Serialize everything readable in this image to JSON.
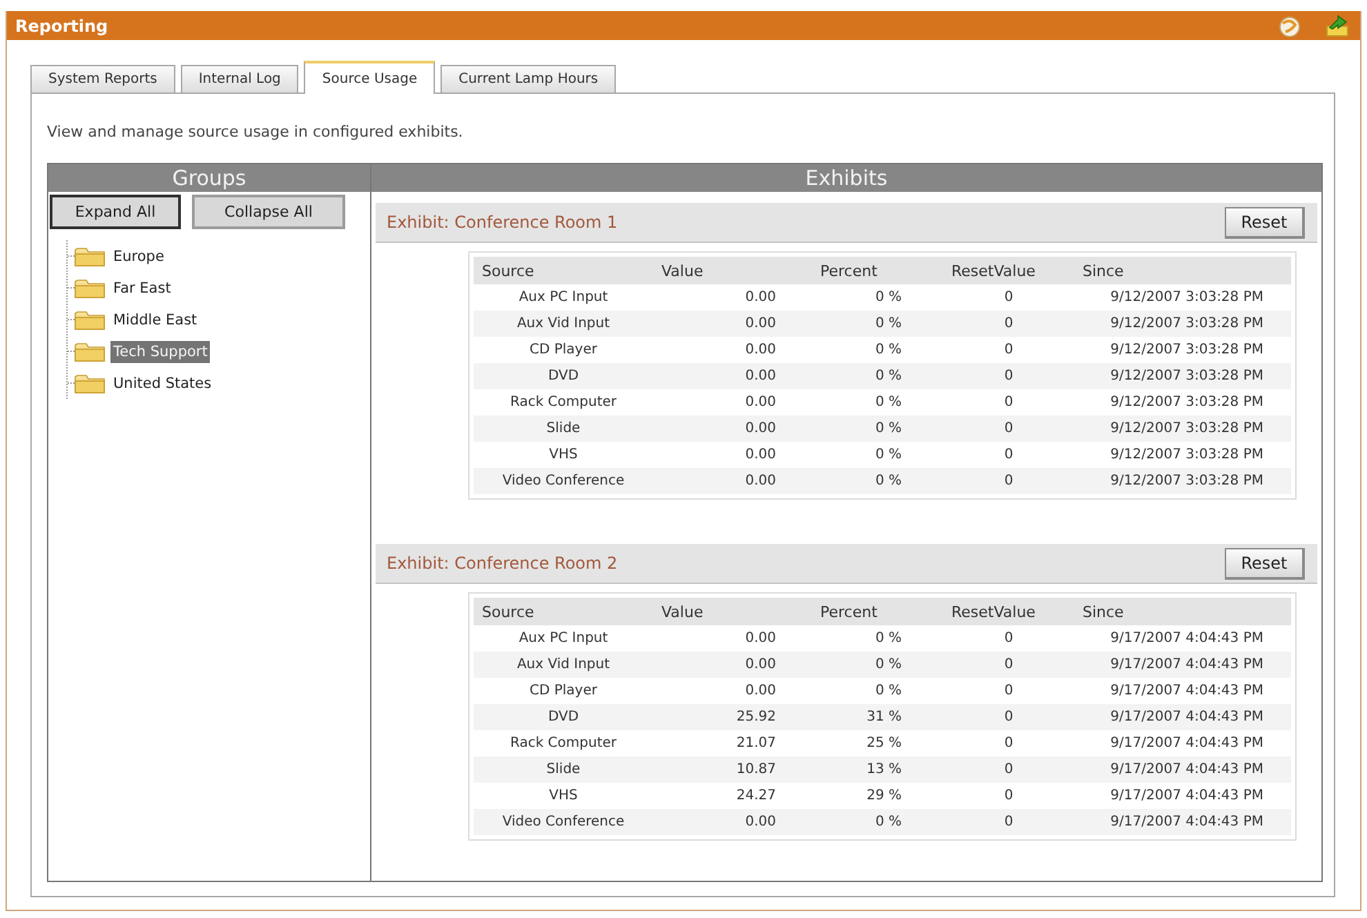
{
  "window": {
    "title": "Reporting"
  },
  "tabs": [
    {
      "label": "System Reports",
      "selected": false
    },
    {
      "label": "Internal Log",
      "selected": false
    },
    {
      "label": "Source Usage",
      "selected": true
    },
    {
      "label": "Current Lamp Hours",
      "selected": false
    }
  ],
  "description": "View and manage source usage in configured exhibits.",
  "groups": {
    "title": "Groups",
    "buttons": [
      {
        "label": "Expand All",
        "focused": true
      },
      {
        "label": "Collapse All",
        "focused": false
      }
    ],
    "tree": [
      {
        "label": "Europe",
        "selected": false
      },
      {
        "label": "Far East",
        "selected": false
      },
      {
        "label": "Middle East",
        "selected": false
      },
      {
        "label": "Tech Support",
        "selected": true
      },
      {
        "label": "United States",
        "selected": false
      }
    ]
  },
  "exhibits": {
    "title": "Exhibits",
    "items": [
      {
        "title": "Exhibit: Conference Room 1",
        "button": "Reset",
        "columns": [
          "Source",
          "Value",
          "Percent",
          "ResetValue",
          "Since"
        ],
        "rows": [
          [
            "Aux PC Input",
            "0.00",
            "0 %",
            "0",
            "9/12/2007 3:03:28 PM"
          ],
          [
            "Aux Vid Input",
            "0.00",
            "0 %",
            "0",
            "9/12/2007 3:03:28 PM"
          ],
          [
            "CD Player",
            "0.00",
            "0 %",
            "0",
            "9/12/2007 3:03:28 PM"
          ],
          [
            "DVD",
            "0.00",
            "0 %",
            "0",
            "9/12/2007 3:03:28 PM"
          ],
          [
            "Rack Computer",
            "0.00",
            "0 %",
            "0",
            "9/12/2007 3:03:28 PM"
          ],
          [
            "Slide",
            "0.00",
            "0 %",
            "0",
            "9/12/2007 3:03:28 PM"
          ],
          [
            "VHS",
            "0.00",
            "0 %",
            "0",
            "9/12/2007 3:03:28 PM"
          ],
          [
            "Video Conference",
            "0.00",
            "0 %",
            "0",
            "9/12/2007 3:03:28 PM"
          ]
        ]
      },
      {
        "title": "Exhibit: Conference Room 2",
        "button": "Reset",
        "columns": [
          "Source",
          "Value",
          "Percent",
          "ResetValue",
          "Since"
        ],
        "rows": [
          [
            "Aux PC Input",
            "0.00",
            "0 %",
            "0",
            "9/17/2007 4:04:43 PM"
          ],
          [
            "Aux Vid Input",
            "0.00",
            "0 %",
            "0",
            "9/17/2007 4:04:43 PM"
          ],
          [
            "CD Player",
            "0.00",
            "0 %",
            "0",
            "9/17/2007 4:04:43 PM"
          ],
          [
            "DVD",
            "25.92",
            "31 %",
            "0",
            "9/17/2007 4:04:43 PM"
          ],
          [
            "Rack Computer",
            "21.07",
            "25 %",
            "0",
            "9/17/2007 4:04:43 PM"
          ],
          [
            "Slide",
            "10.87",
            "13 %",
            "0",
            "9/17/2007 4:04:43 PM"
          ],
          [
            "VHS",
            "24.27",
            "29 %",
            "0",
            "9/17/2007 4:04:43 PM"
          ],
          [
            "Video Conference",
            "0.00",
            "0 %",
            "0",
            "9/17/2007 4:04:43 PM"
          ]
        ]
      }
    ]
  }
}
